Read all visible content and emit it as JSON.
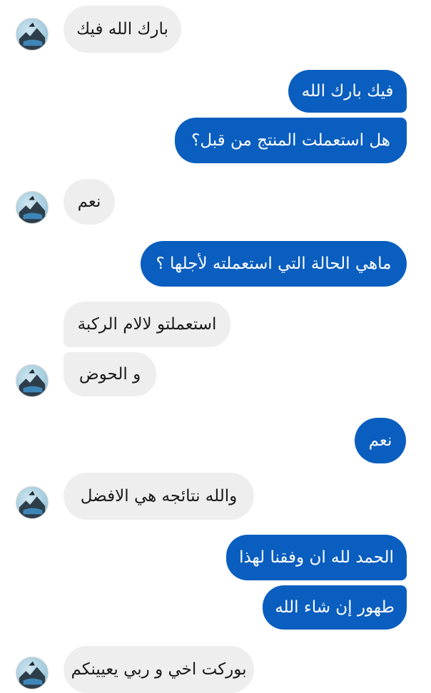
{
  "messages": [
    {
      "direction": "incoming",
      "text": "بارك الله فيك",
      "avatar": "contact-avatar"
    },
    {
      "direction": "outgoing",
      "text": "فيك بارك الله"
    },
    {
      "direction": "outgoing",
      "text": "هل استعملت المنتج من قبل؟"
    },
    {
      "direction": "incoming",
      "text": "نعم",
      "avatar": "contact-avatar"
    },
    {
      "direction": "outgoing",
      "text": "ماهي الحالة التي استعملته لأجلها ؟"
    },
    {
      "direction": "incoming",
      "text": "استعملتو لالام الركبة"
    },
    {
      "direction": "incoming",
      "text": "و الحوض",
      "avatar": "contact-avatar"
    },
    {
      "direction": "outgoing",
      "text": "نعم"
    },
    {
      "direction": "incoming",
      "text": "والله نتائجه هي الافضل",
      "avatar": "contact-avatar"
    },
    {
      "direction": "outgoing",
      "text": "الحمد لله ان وفقنا لهذا"
    },
    {
      "direction": "outgoing",
      "text": "طهور إن شاء الله"
    },
    {
      "direction": "incoming",
      "text": "بوركت اخي و ربي يعيينكم",
      "avatar": "contact-avatar"
    }
  ],
  "colors": {
    "outgoing_bubble": "#0a5ebf",
    "incoming_bubble": "#eeeeee",
    "outgoing_text": "#ffffff",
    "incoming_text": "#1a1a1a"
  }
}
